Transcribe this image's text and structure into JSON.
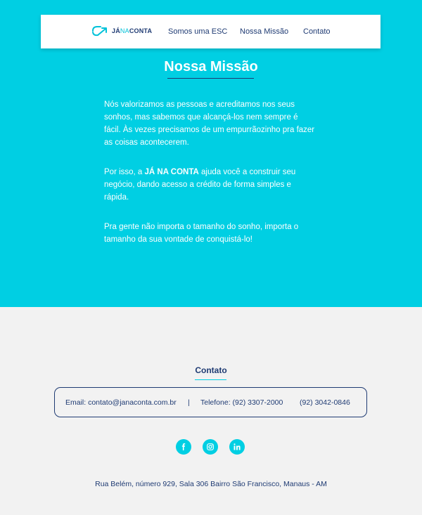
{
  "nav": {
    "logo": {
      "ja": "JÁ",
      "na": "NA",
      "conta": "CONTA"
    },
    "links": [
      "Somos uma ESC",
      "Nossa Missão",
      "Contato"
    ]
  },
  "mission": {
    "title": "Nossa Missão",
    "paragraph1": "Nós valorizamos as pessoas e acreditamos nos seus sonhos, mas sabemos que alcançá-los nem sempre é fácil. Às vezes precisamos de um empurrãozinho pra fazer as coisas acontecerem.",
    "paragraph2_before": "Por isso, a ",
    "paragraph2_brand": "JÁ NA CONTA",
    "paragraph2_after": " ajuda você a construir seu negócio, dando acesso a crédito de forma simples e rápida.",
    "paragraph3": "Pra gente não importa o tamanho do sonho, importa o tamanho da sua vontade de conquistá-lo!"
  },
  "contact": {
    "title": "Contato",
    "email": "Email: contato@janaconta.com.br",
    "separator": "|",
    "phone": "Telefone: (92) 3307-2000",
    "phone2": "(92) 3042-0846"
  },
  "social": {
    "icons": [
      "facebook-icon",
      "instagram-icon",
      "linkedin-icon"
    ]
  },
  "footer": {
    "address": "Rua Belém, número 929, Sala 306  Bairro São Francisco, Manaus - AM"
  },
  "colors": {
    "hero_bg": "#00cfe3",
    "navy": "#1f3b73",
    "page_bg": "#f2f2f2"
  }
}
